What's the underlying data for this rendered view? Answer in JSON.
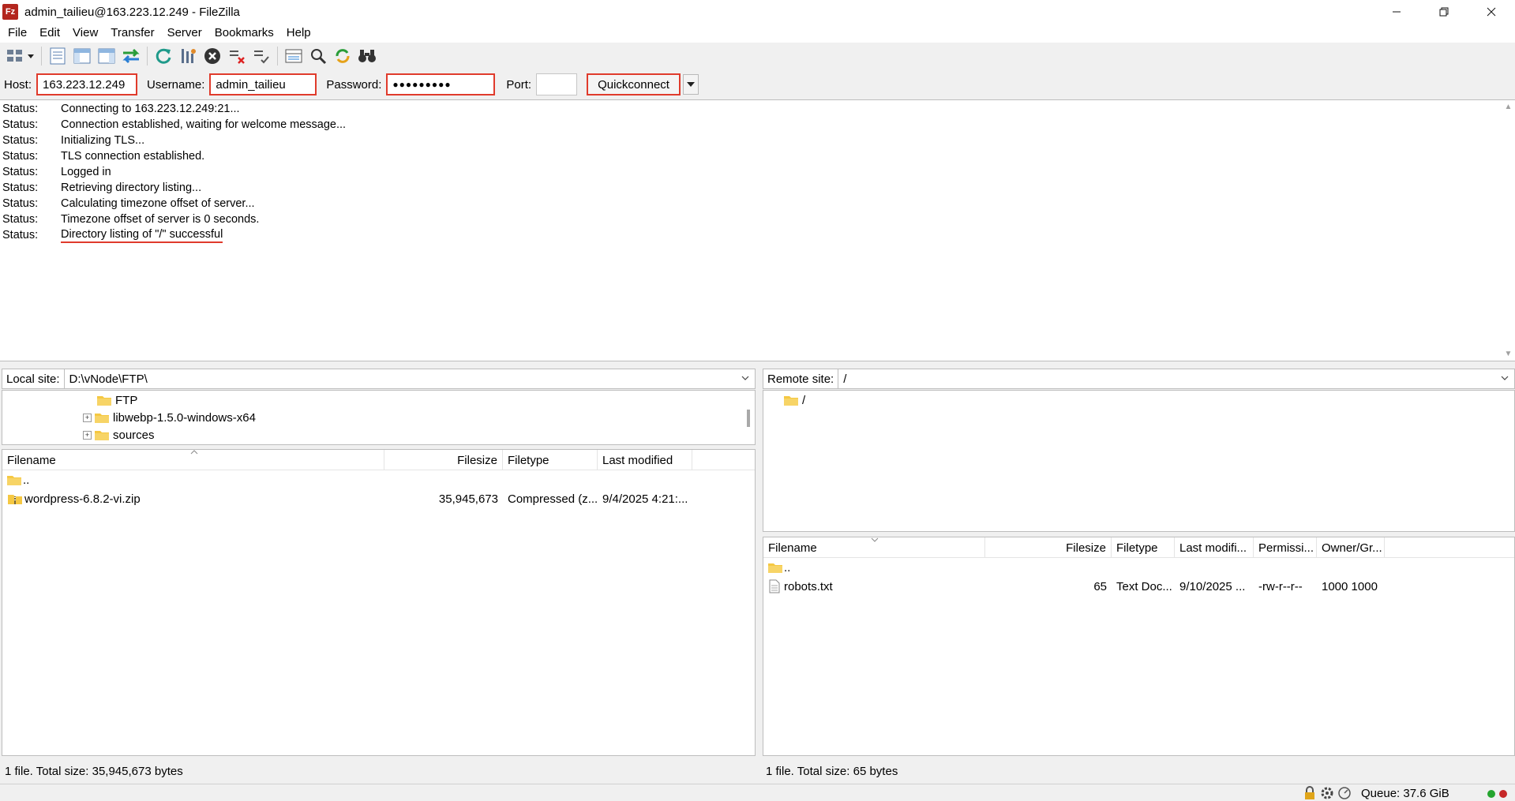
{
  "window": {
    "title": "admin_tailieu@163.223.12.249 - FileZilla",
    "app_icon_text": "Fz"
  },
  "menu": [
    "File",
    "Edit",
    "View",
    "Transfer",
    "Server",
    "Bookmarks",
    "Help"
  ],
  "quickconnect": {
    "host_label": "Host:",
    "host_value": "163.223.12.249",
    "username_label": "Username:",
    "username_value": "admin_tailieu",
    "password_label": "Password:",
    "password_value": "●●●●●●●●●",
    "port_label": "Port:",
    "port_value": "",
    "button_label": "Quickconnect"
  },
  "log": [
    {
      "label": "Status:",
      "message": "Connecting to 163.223.12.249:21..."
    },
    {
      "label": "Status:",
      "message": "Connection established, waiting for welcome message..."
    },
    {
      "label": "Status:",
      "message": "Initializing TLS..."
    },
    {
      "label": "Status:",
      "message": "TLS connection established."
    },
    {
      "label": "Status:",
      "message": "Logged in"
    },
    {
      "label": "Status:",
      "message": "Retrieving directory listing..."
    },
    {
      "label": "Status:",
      "message": "Calculating timezone offset of server..."
    },
    {
      "label": "Status:",
      "message": "Timezone offset of server is 0 seconds."
    },
    {
      "label": "Status:",
      "message": "Directory listing of \"/\" successful"
    }
  ],
  "local": {
    "site_label": "Local site:",
    "path": "D:\\vNode\\FTP\\",
    "tree": [
      {
        "name": "FTP",
        "expandable": false
      },
      {
        "name": "libwebp-1.5.0-windows-x64",
        "expandable": true
      },
      {
        "name": "sources",
        "expandable": true
      }
    ],
    "columns": [
      "Filename",
      "Filesize",
      "Filetype",
      "Last modified"
    ],
    "files": [
      {
        "name": "..",
        "size": "",
        "type": "",
        "modified": ""
      },
      {
        "name": "wordpress-6.8.2-vi.zip",
        "size": "35,945,673",
        "type": "Compressed (z...",
        "modified": "9/4/2025 4:21:..."
      }
    ],
    "status": "1 file. Total size: 35,945,673 bytes"
  },
  "remote": {
    "site_label": "Remote site:",
    "path": "/",
    "tree": [
      {
        "name": "/"
      }
    ],
    "columns": [
      "Filename",
      "Filesize",
      "Filetype",
      "Last modifi...",
      "Permissi...",
      "Owner/Gr..."
    ],
    "files": [
      {
        "name": "..",
        "size": "",
        "type": "",
        "modified": "",
        "perms": "",
        "owner": ""
      },
      {
        "name": "robots.txt",
        "size": "65",
        "type": "Text Doc...",
        "modified": "9/10/2025 ...",
        "perms": "-rw-r--r--",
        "owner": "1000 1000"
      }
    ],
    "status": "1 file. Total size: 65 bytes"
  },
  "queue": {
    "text": "Queue: 37.6 GiB"
  },
  "colors": {
    "highlight": "#e03b2c",
    "folder": "#f5c842",
    "accent": "#2a7fd4"
  }
}
